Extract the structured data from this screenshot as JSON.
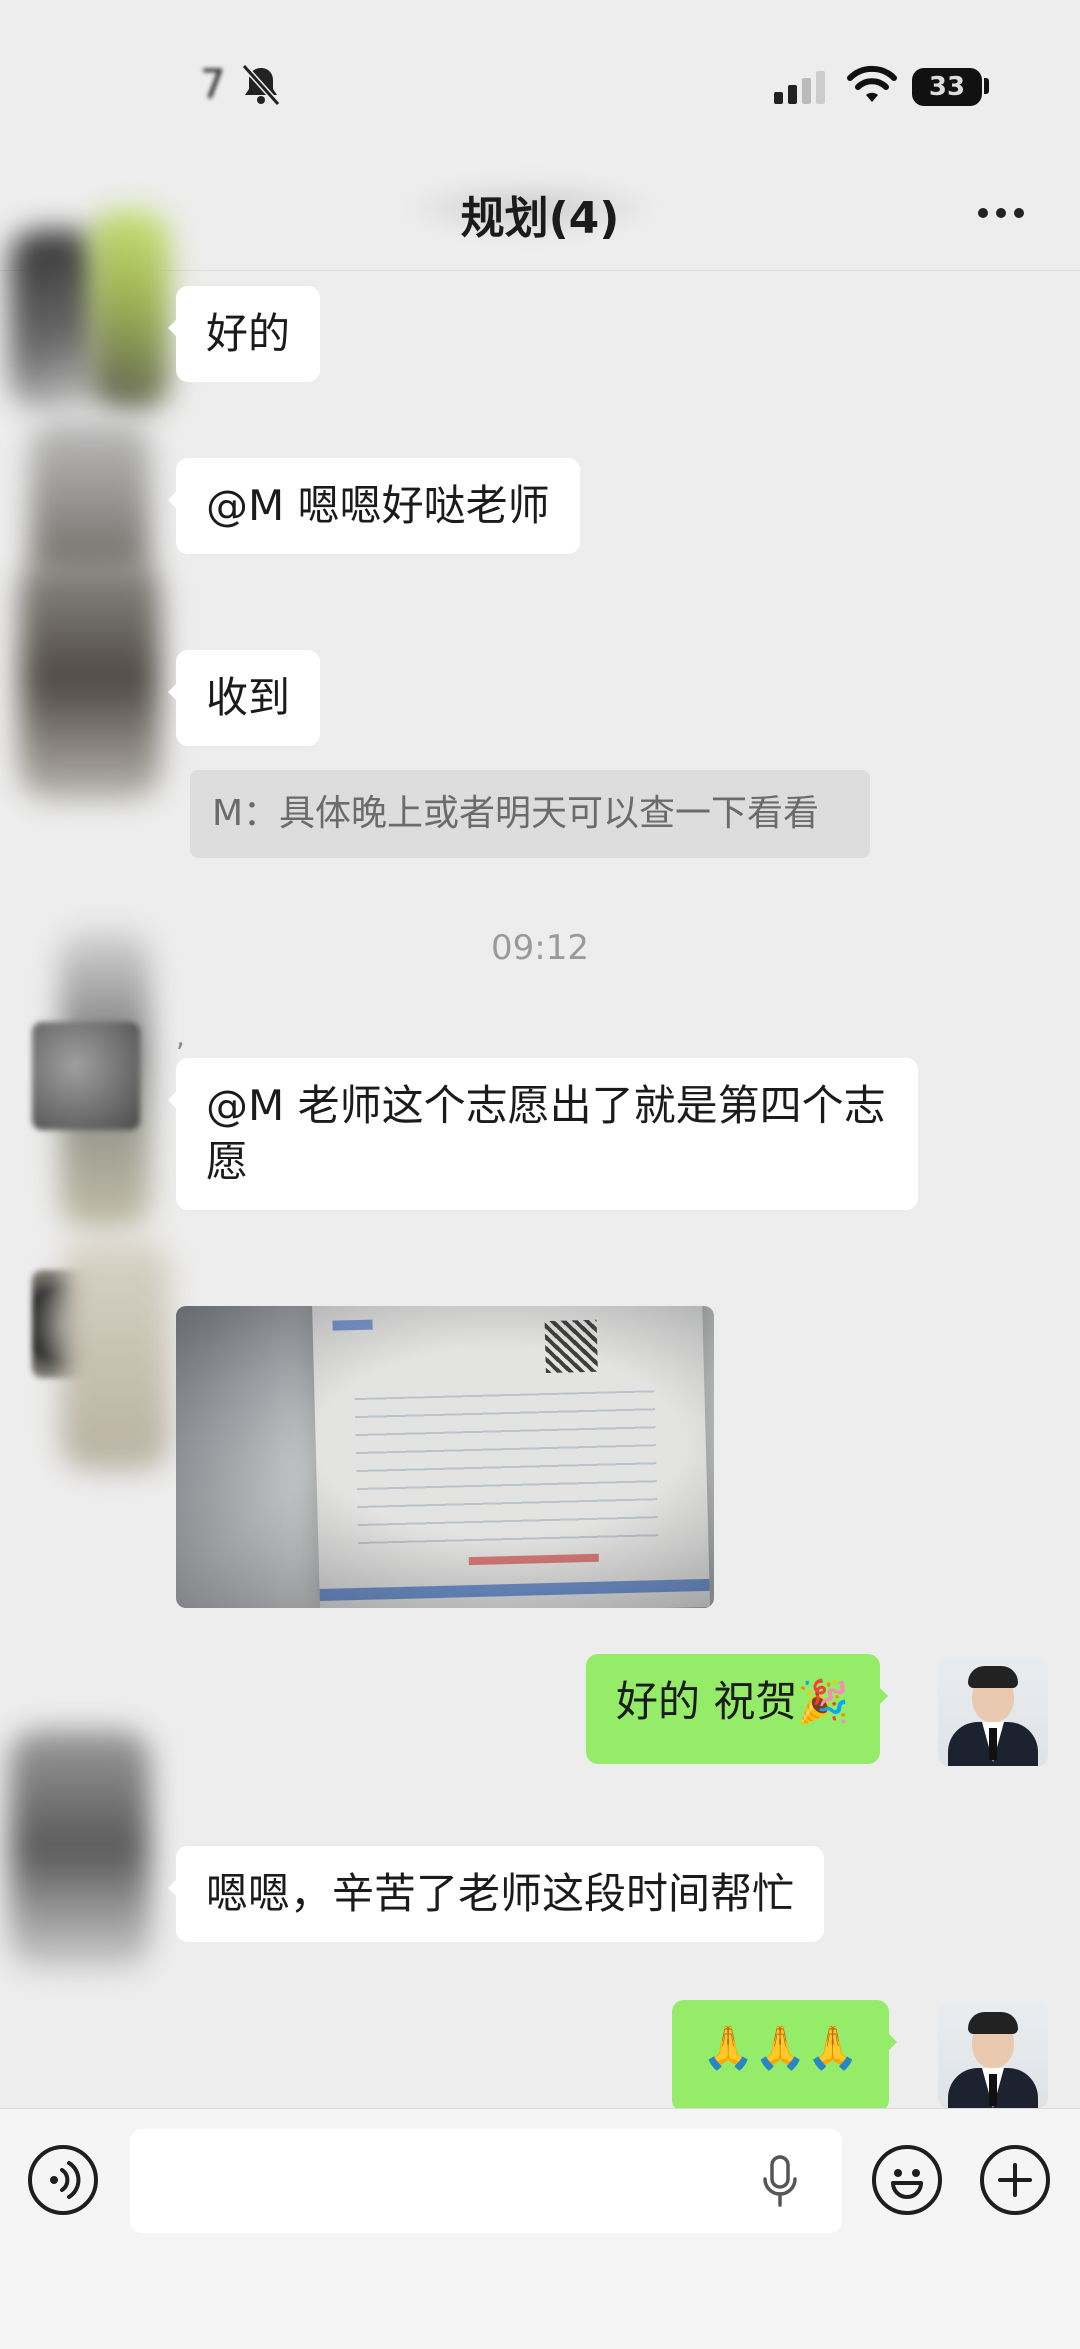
{
  "status_bar": {
    "time": "7",
    "battery": "33"
  },
  "header": {
    "title": "规划(4)"
  },
  "messages": [
    {
      "text": "好的"
    },
    {
      "text": "@M 嗯嗯好哒老师"
    },
    {
      "text": "收到"
    },
    {
      "quote": "M：具体晚上或者明天可以查一下看看"
    },
    {
      "timestamp": "09:12"
    },
    {
      "sender": ","
    },
    {
      "text": "@M 老师这个志愿出了就是第四个志愿"
    },
    {
      "text": "好的 祝贺🎉"
    },
    {
      "text": "嗯嗯，辛苦了老师这段时间帮忙"
    },
    {
      "text": "🙏🙏🙏"
    }
  ],
  "colors": {
    "background": "#ededed",
    "my_bubble": "#95ec69",
    "other_bubble": "#ffffff"
  },
  "icons": [
    "bell-slash-icon",
    "signal-icon",
    "wifi-icon",
    "more-icon",
    "voice-icon",
    "microphone-icon",
    "emoji-icon",
    "plus-icon"
  ]
}
